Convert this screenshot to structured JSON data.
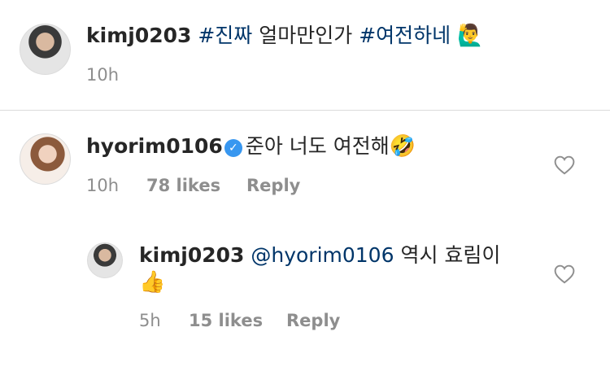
{
  "caption": {
    "username": "kimj0203",
    "text_parts": [
      "#진짜",
      " 얼마만인가 ",
      "#여전하네"
    ],
    "emoji": "🙋‍♂️",
    "time": "10h"
  },
  "comment1": {
    "username": "hyorim0106",
    "text": "준아 너도 여전해",
    "emoji": "🤣",
    "time": "10h",
    "likes": "78 likes",
    "reply": "Reply"
  },
  "reply1": {
    "username": "kimj0203",
    "mention": "@hyorim0106",
    "text": " 역시 효림이",
    "emoji": "👍",
    "time": "5h",
    "likes": "15 likes",
    "reply": "Reply"
  },
  "colors": {
    "hashtag": "#003569",
    "verified": "#3897f0",
    "meta": "#8e8e8e",
    "divider": "#dbdbdb"
  }
}
